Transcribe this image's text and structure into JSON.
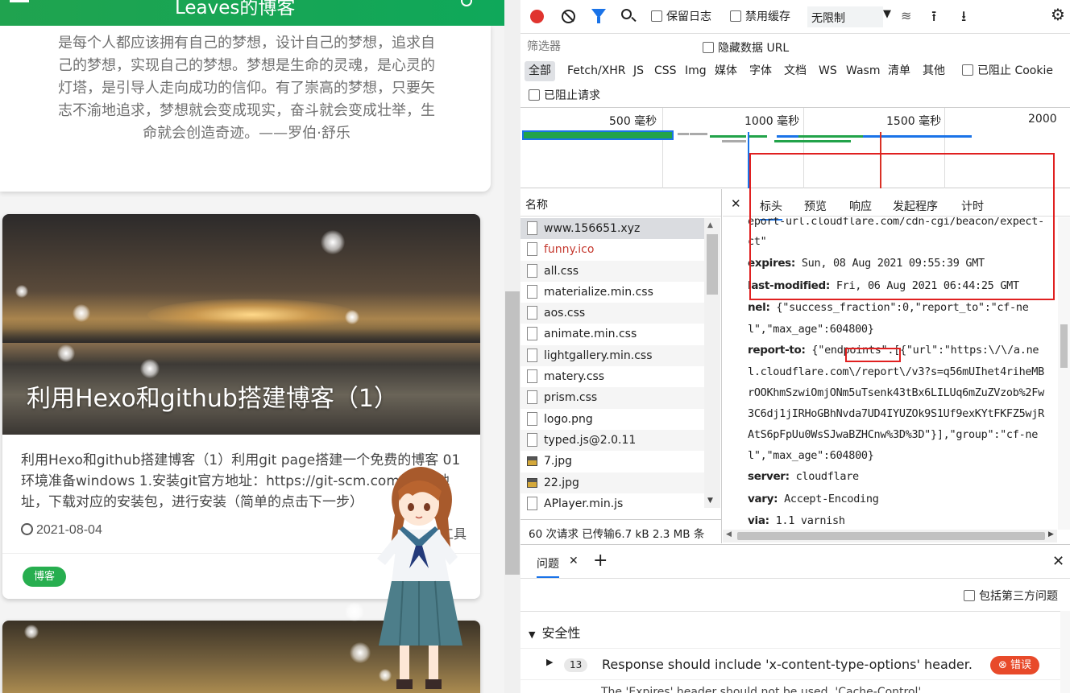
{
  "blog": {
    "title": "Leaves的博客",
    "quote": "是每个人都应该拥有自己的梦想，设计自己的梦想，追求自己的梦想，实现自己的梦想。梦想是生命的灵魂，是心灵的灯塔，是引导人走向成功的信仰。有了崇高的梦想，只要矢志不渝地追求，梦想就会变成现实，奋斗就会变成壮举，生命就会创造奇迹。——罗伯·舒乐",
    "post1": {
      "title": "利用Hexo和github搭建博客（1）",
      "excerpt": "利用Hexo和github搭建博客（1）利用git page搭建一个免费的博客 01 环境准备windows 1.安装git官方地址：https://git-scm.com/ 下载地址，下载对应的安装包，进行安装（简单的点击下一步）",
      "date": "2021-08-04",
      "category": "工具",
      "tag": "博客"
    }
  },
  "devtools": {
    "toolbar": {
      "preserve_log": "保留日志",
      "disable_cache": "禁用缓存",
      "throttle": "无限制"
    },
    "filter": {
      "placeholder": "筛选器",
      "hide_data_urls": "隐藏数据 URL"
    },
    "types": [
      "全部",
      "Fetch/XHR",
      "JS",
      "CSS",
      "Img",
      "媒体",
      "字体",
      "文档",
      "WS",
      "Wasm",
      "清单",
      "其他"
    ],
    "blocked_cookies": "已阻止 Cookie",
    "blocked_requests": "已阻止请求",
    "timeline_ticks": [
      "500 毫秒",
      "1000 毫秒",
      "1500 毫秒",
      "2000"
    ],
    "names_header": "名称",
    "requests": [
      "www.156651.xyz",
      "funny.ico",
      "all.css",
      "materialize.min.css",
      "aos.css",
      "animate.min.css",
      "lightgallery.min.css",
      "matery.css",
      "prism.css",
      "logo.png",
      "typed.js@2.0.11",
      "7.jpg",
      "22.jpg",
      "APlayer.min.js"
    ],
    "summary": "60 次请求  已传输6.7 kB  2.3 MB 条",
    "detail_tabs": [
      "标头",
      "预览",
      "响应",
      "发起程序",
      "计时"
    ],
    "headers": {
      "line_top": "eport-url.cloudflare.com/cdn-cgi/beacon/expect-",
      "line_ct": "ct\"",
      "expires_key": "expires:",
      "expires_val": "Sun, 08 Aug 2021 09:55:39 GMT",
      "lastmod_key": "last-modified:",
      "lastmod_val": "Fri, 06 Aug 2021 06:44:25 GMT",
      "nel_key": "nel:",
      "nel_val1": "{\"success_fraction\":0,\"report_to\":\"cf-ne",
      "nel_val2": "l\",\"max_age\":604800}",
      "reportto_key": "report-to:",
      "reportto_val1": "{\"endpoints\":[{\"url\":\"https:\\/\\/a.ne",
      "reportto_val2": "l.cloudflare.com\\/report\\/v3?s=q56mUIhet4riheMB",
      "reportto_val3": "rOOKhmSzwiOmjONm5uTsenk43tBx6LILUq6mZuZVzob%2Fw",
      "reportto_val4": "3C6dj1jIRHoGBhNvda7UD4IYUZOk9S1Uf9exKYtFKFZ5wjR",
      "reportto_val5": "AtS6pFpUu0WsSJwaBZHCnw%3D%3D\"}],\"group\":\"cf-ne",
      "reportto_val6": "l\",\"max_age\":604800}",
      "server_key": "server:",
      "server_val": "cloudflare",
      "vary_key": "vary:",
      "vary_val": "Accept-Encoding",
      "via_key": "via:",
      "via_val": "1.1 varnish"
    },
    "drawer": {
      "issues_tab": "问题",
      "include_third_party": "包括第三方问题",
      "category": "安全性",
      "issue_count": "13",
      "issue_text": "Response should include 'x-content-type-options' header.",
      "issue_level": "错误",
      "next_issue": "The 'Expires' header should not be used, 'Cache-Control'"
    }
  }
}
